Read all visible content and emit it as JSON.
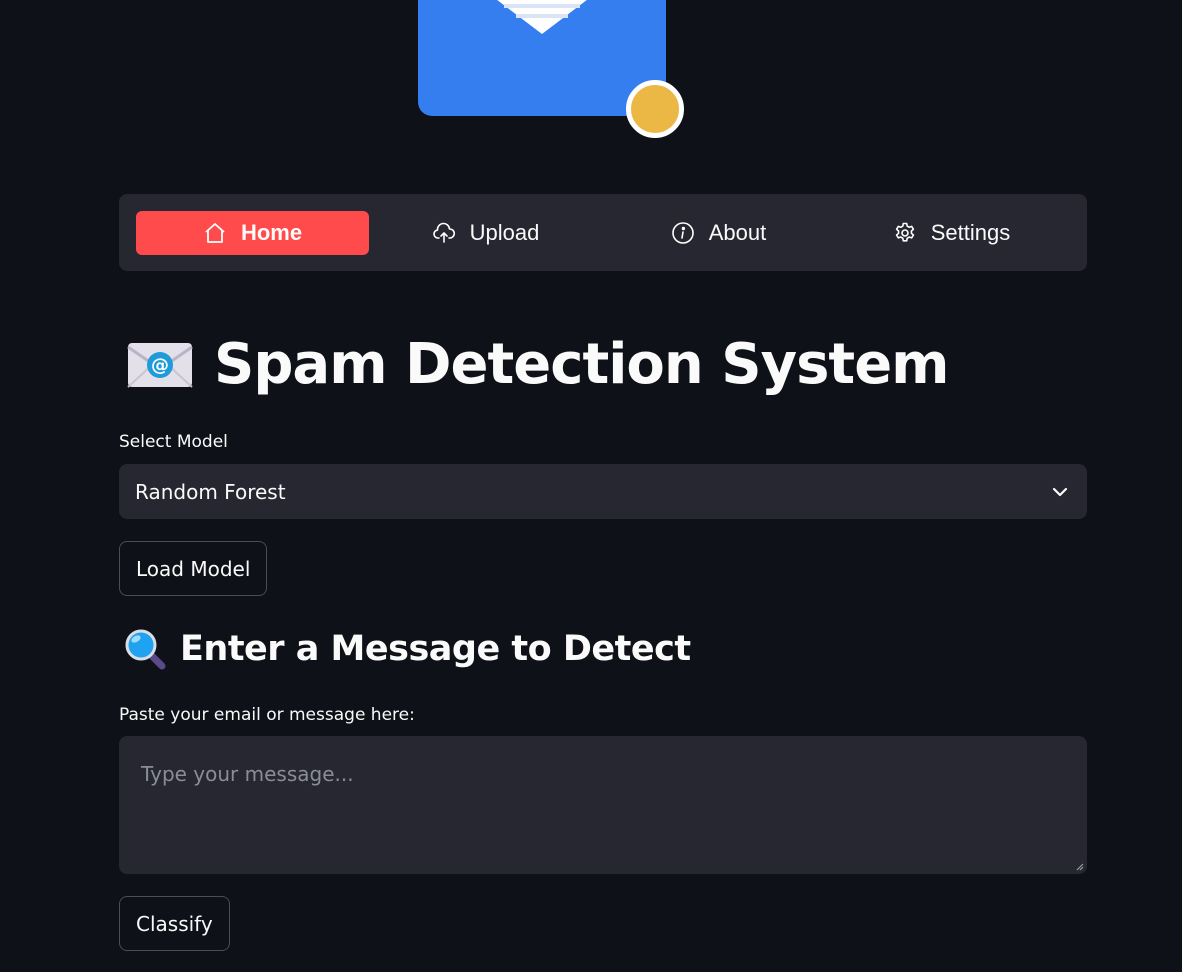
{
  "nav": {
    "items": [
      {
        "label": "Home",
        "icon": "home-icon",
        "active": true
      },
      {
        "label": "Upload",
        "icon": "cloud-upload-icon",
        "active": false
      },
      {
        "label": "About",
        "icon": "info-icon",
        "active": false
      },
      {
        "label": "Settings",
        "icon": "gear-icon",
        "active": false
      }
    ],
    "active_color": "#ff4b4b"
  },
  "header": {
    "title": "Spam Detection System",
    "title_icon": "envelope-at-icon"
  },
  "model_select": {
    "label": "Select Model",
    "value": "Random Forest"
  },
  "load_button": {
    "label": "Load Model"
  },
  "detect_section": {
    "heading": "Enter a Message to Detect",
    "heading_icon": "magnifying-glass-icon",
    "input_label": "Paste your email or message here:",
    "placeholder": "Type your message..."
  },
  "classify_button": {
    "label": "Classify"
  },
  "theme": {
    "background": "#0e1117",
    "surface": "#262730",
    "logo_blue": "#357ef0",
    "logo_badge": "#ecb845"
  }
}
